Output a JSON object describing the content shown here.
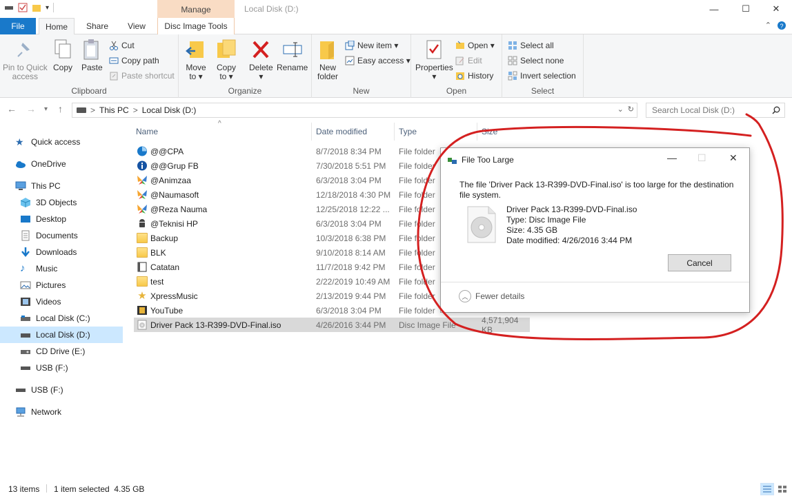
{
  "window": {
    "title": "Local Disk (D:)",
    "context_tab": "Manage",
    "minimize": "—",
    "maximize": "☐",
    "close": "✕"
  },
  "ribbon_tabs": {
    "file": "File",
    "home": "Home",
    "share": "Share",
    "view": "View",
    "disc_image_tools": "Disc Image Tools"
  },
  "ribbon": {
    "clipboard": {
      "label": "Clipboard",
      "pin": [
        "Pin to Quick",
        "access"
      ],
      "copy": "Copy",
      "paste": "Paste",
      "cut": "Cut",
      "copy_path": "Copy path",
      "paste_shortcut": "Paste shortcut"
    },
    "organize": {
      "label": "Organize",
      "move_to": [
        "Move",
        "to ▾"
      ],
      "copy_to": [
        "Copy",
        "to ▾"
      ],
      "delete": [
        "Delete",
        "▾"
      ],
      "rename": "Rename"
    },
    "new": {
      "label": "New",
      "new_folder": [
        "New",
        "folder"
      ],
      "new_item": "New item ▾",
      "easy_access": "Easy access ▾"
    },
    "open": {
      "label": "Open",
      "properties": [
        "Properties",
        "▾"
      ],
      "open": "Open ▾",
      "edit": "Edit",
      "history": "History"
    },
    "select": {
      "label": "Select",
      "select_all": "Select all",
      "select_none": "Select none",
      "invert": "Invert selection"
    }
  },
  "address": {
    "this_pc": "This PC",
    "sep1": ">",
    "sep2": ">",
    "current": "Local Disk (D:)",
    "search_placeholder": "Search Local Disk (D:)"
  },
  "nav": {
    "quick_access": "Quick access",
    "onedrive": "OneDrive",
    "this_pc": "This PC",
    "objects3d": "3D Objects",
    "desktop": "Desktop",
    "documents": "Documents",
    "downloads": "Downloads",
    "music": "Music",
    "pictures": "Pictures",
    "videos": "Videos",
    "local_c": "Local Disk (C:)",
    "local_d": "Local Disk (D:)",
    "cd_e": "CD Drive (E:)",
    "usb_f": "USB (F:)",
    "usb_f2": "USB (F:)",
    "network": "Network"
  },
  "columns": {
    "name": "Name",
    "date": "Date modified",
    "type": "Type",
    "size": "Size"
  },
  "files": [
    {
      "name": "@@CPA",
      "date": "8/7/2018 8:34 PM",
      "type": "File folder",
      "size": ""
    },
    {
      "name": "@@Grup FB",
      "date": "7/30/2018 5:51 PM",
      "type": "File folder",
      "size": ""
    },
    {
      "name": "@Animzaa",
      "date": "6/3/2018 3:04 PM",
      "type": "File folder",
      "size": ""
    },
    {
      "name": "@Naumasoft",
      "date": "12/18/2018 4:30 PM",
      "type": "File folder",
      "size": ""
    },
    {
      "name": "@Reza Nauma",
      "date": "12/25/2018 12:22 ...",
      "type": "File folder",
      "size": ""
    },
    {
      "name": "@Teknisi HP",
      "date": "6/3/2018 3:04 PM",
      "type": "File folder",
      "size": ""
    },
    {
      "name": "Backup",
      "date": "10/3/2018 6:38 PM",
      "type": "File folder",
      "size": ""
    },
    {
      "name": "BLK",
      "date": "9/10/2018 8:14 AM",
      "type": "File folder",
      "size": ""
    },
    {
      "name": "Catatan",
      "date": "11/7/2018 9:42 PM",
      "type": "File folder",
      "size": ""
    },
    {
      "name": "test",
      "date": "2/22/2019 10:49 AM",
      "type": "File folder",
      "size": ""
    },
    {
      "name": "XpressMusic",
      "date": "2/13/2019 9:44 PM",
      "type": "File folder",
      "size": ""
    },
    {
      "name": "YouTube",
      "date": "6/3/2018 3:04 PM",
      "type": "File folder",
      "size": ""
    },
    {
      "name": "Driver Pack 13-R399-DVD-Final.iso",
      "date": "4/26/2016 3:44 PM",
      "type": "Disc Image File",
      "size": "4,571,904 KB"
    }
  ],
  "status": {
    "items": "13 items",
    "selected": "1 item selected  4.35 GB"
  },
  "dialog": {
    "title": "File Too Large",
    "message": "The file 'Driver Pack 13-R399-DVD-Final.iso' is too large for the destination file system.",
    "file_name": "Driver Pack 13-R399-DVD-Final.iso",
    "file_type": "Type: Disc Image File",
    "file_size": "Size: 4.35 GB",
    "file_date": "Date modified: 4/26/2016 3:44 PM",
    "cancel": "Cancel",
    "fewer_details": "Fewer details",
    "minimize": "—",
    "maximize": "☐",
    "close": "✕"
  },
  "colors": {
    "file_tab": "#1979ca",
    "manage_tab": "#f9dcc4",
    "selection": "#cce8ff",
    "annotation": "#d42020"
  }
}
